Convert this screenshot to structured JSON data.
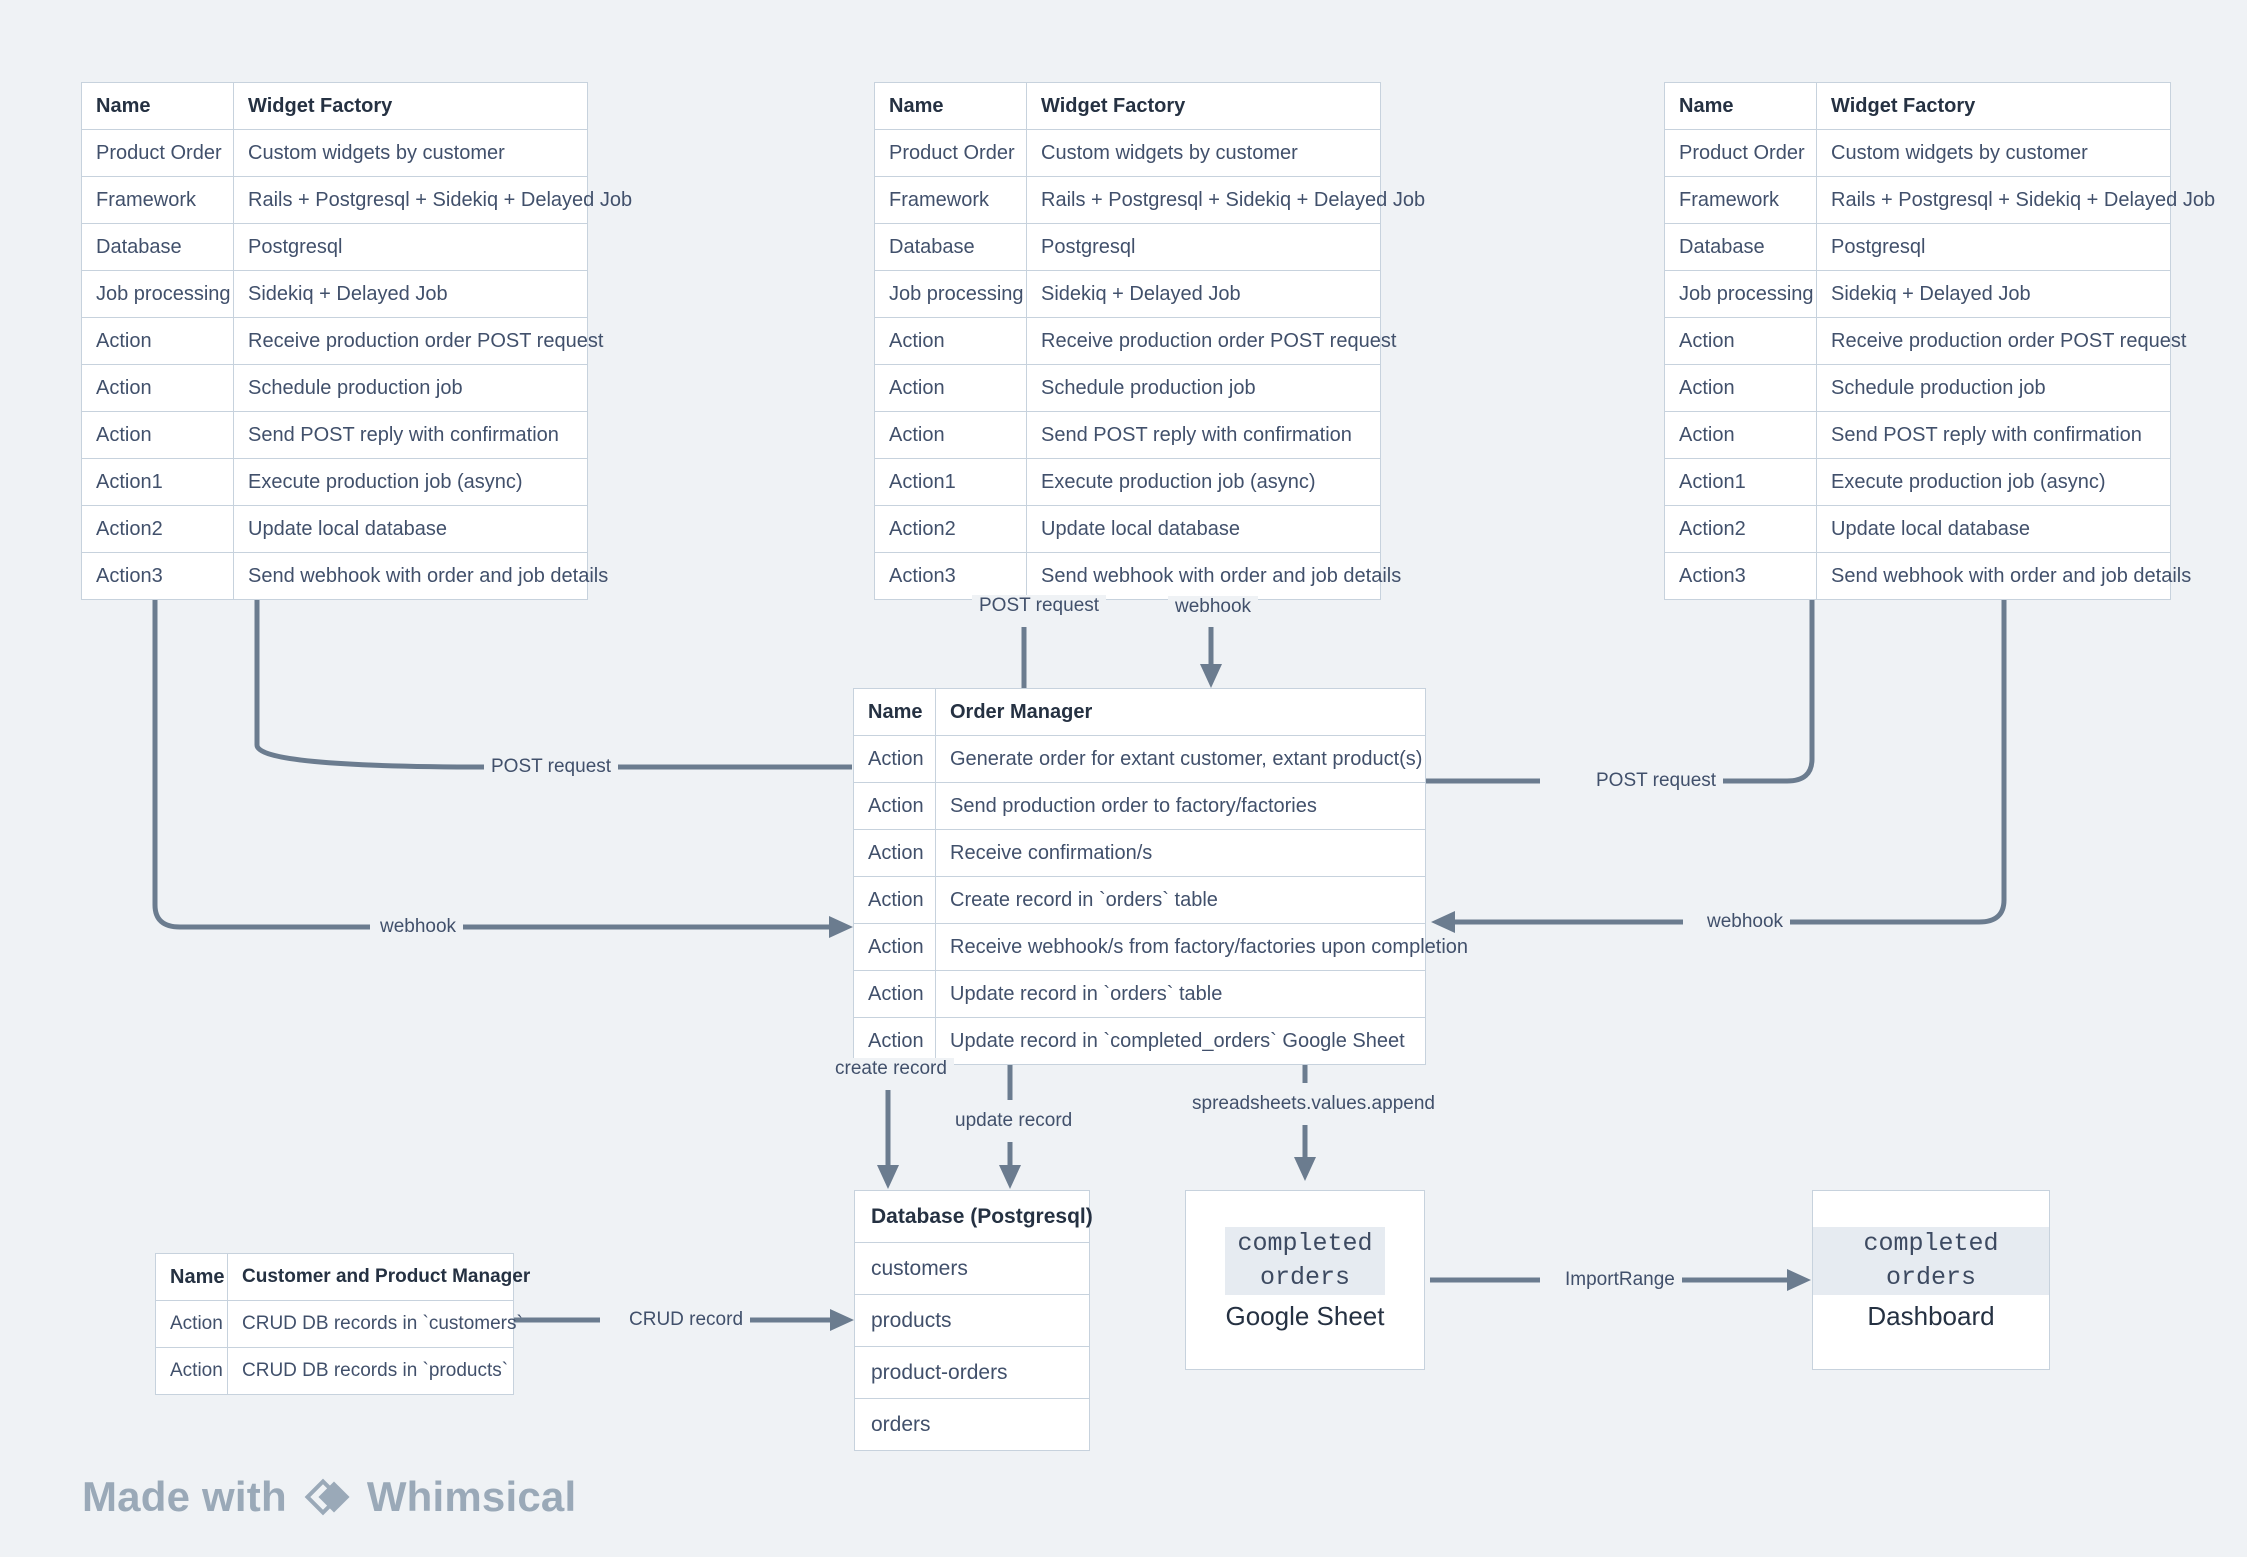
{
  "canvas": {
    "background": "#eff2f5",
    "line_color": "#6b7c8f",
    "border_color": "#c7d2dd",
    "text_color": "#41506b"
  },
  "factories": [
    {
      "id": "factory-left",
      "header": {
        "name": "Name",
        "value": "Widget Factory"
      },
      "rows": [
        {
          "name": "Product Order",
          "value": "Custom widgets by customer"
        },
        {
          "name": "Framework",
          "value": "Rails + Postgresql + Sidekiq + Delayed Job"
        },
        {
          "name": "Database",
          "value": "Postgresql"
        },
        {
          "name": "Job processing",
          "value": "Sidekiq + Delayed Job"
        },
        {
          "name": "Action",
          "value": "Receive production order POST request"
        },
        {
          "name": "Action",
          "value": "Schedule production job"
        },
        {
          "name": "Action",
          "value": "Send POST reply with confirmation"
        },
        {
          "name": "Action1",
          "value": "Execute production job (async)"
        },
        {
          "name": "Action2",
          "value": "Update local database"
        },
        {
          "name": "Action3",
          "value": "Send webhook with order and job details"
        }
      ]
    },
    {
      "id": "factory-center",
      "header": {
        "name": "Name",
        "value": "Widget Factory"
      },
      "rows": [
        {
          "name": "Product Order",
          "value": "Custom widgets by customer"
        },
        {
          "name": "Framework",
          "value": "Rails + Postgresql + Sidekiq + Delayed Job"
        },
        {
          "name": "Database",
          "value": "Postgresql"
        },
        {
          "name": "Job processing",
          "value": "Sidekiq + Delayed Job"
        },
        {
          "name": "Action",
          "value": "Receive production order POST request"
        },
        {
          "name": "Action",
          "value": "Schedule production job"
        },
        {
          "name": "Action",
          "value": "Send POST reply with confirmation"
        },
        {
          "name": "Action1",
          "value": "Execute production job (async)"
        },
        {
          "name": "Action2",
          "value": "Update local database"
        },
        {
          "name": "Action3",
          "value": "Send webhook with order and job details"
        }
      ]
    },
    {
      "id": "factory-right",
      "header": {
        "name": "Name",
        "value": "Widget Factory"
      },
      "rows": [
        {
          "name": "Product Order",
          "value": "Custom widgets by customer"
        },
        {
          "name": "Framework",
          "value": "Rails + Postgresql + Sidekiq + Delayed Job"
        },
        {
          "name": "Database",
          "value": "Postgresql"
        },
        {
          "name": "Job processing",
          "value": "Sidekiq + Delayed Job"
        },
        {
          "name": "Action",
          "value": "Receive production order POST request"
        },
        {
          "name": "Action",
          "value": "Schedule production job"
        },
        {
          "name": "Action",
          "value": "Send POST reply with confirmation"
        },
        {
          "name": "Action1",
          "value": "Execute production job (async)"
        },
        {
          "name": "Action2",
          "value": "Update local database"
        },
        {
          "name": "Action3",
          "value": "Send webhook with order and job details"
        }
      ]
    }
  ],
  "order_manager": {
    "header": {
      "name": "Name",
      "value": "Order Manager"
    },
    "rows": [
      {
        "name": "Action",
        "value": "Generate order for extant customer, extant product(s)"
      },
      {
        "name": "Action",
        "value": "Send production order to factory/factories"
      },
      {
        "name": "Action",
        "value": "Receive confirmation/s"
      },
      {
        "name": "Action",
        "value": "Create record in `orders` table"
      },
      {
        "name": "Action",
        "value": "Receive webhook/s from factory/factories upon completion"
      },
      {
        "name": "Action",
        "value": "Update record in `orders` table"
      },
      {
        "name": "Action",
        "value": "Update record in `completed_orders` Google Sheet"
      }
    ]
  },
  "cpm": {
    "header": {
      "name": "Name",
      "value": "Customer and Product Manager"
    },
    "rows": [
      {
        "name": "Action",
        "value": "CRUD DB records in `customers`"
      },
      {
        "name": "Action",
        "value": "CRUD DB records in `products`"
      }
    ]
  },
  "database": {
    "header": "Database (Postgresql)",
    "tables": [
      "customers",
      "products",
      "product-orders",
      "orders"
    ]
  },
  "google_sheet": {
    "code": "completed orders",
    "label": "Google Sheet"
  },
  "dashboard": {
    "code": "completed orders",
    "label": "Dashboard"
  },
  "edges": {
    "post_request_center_up": "POST request",
    "webhook_center_down": "webhook",
    "post_request_left": "POST request",
    "webhook_left": "webhook",
    "post_request_right": "POST request",
    "webhook_right": "webhook",
    "create_record": "create record",
    "update_record": "update record",
    "spreadsheets_append": "spreadsheets.values.append",
    "crud_record": "CRUD record",
    "import_range": "ImportRange"
  },
  "watermark": {
    "prefix": "Made with",
    "brand": "Whimsical"
  }
}
